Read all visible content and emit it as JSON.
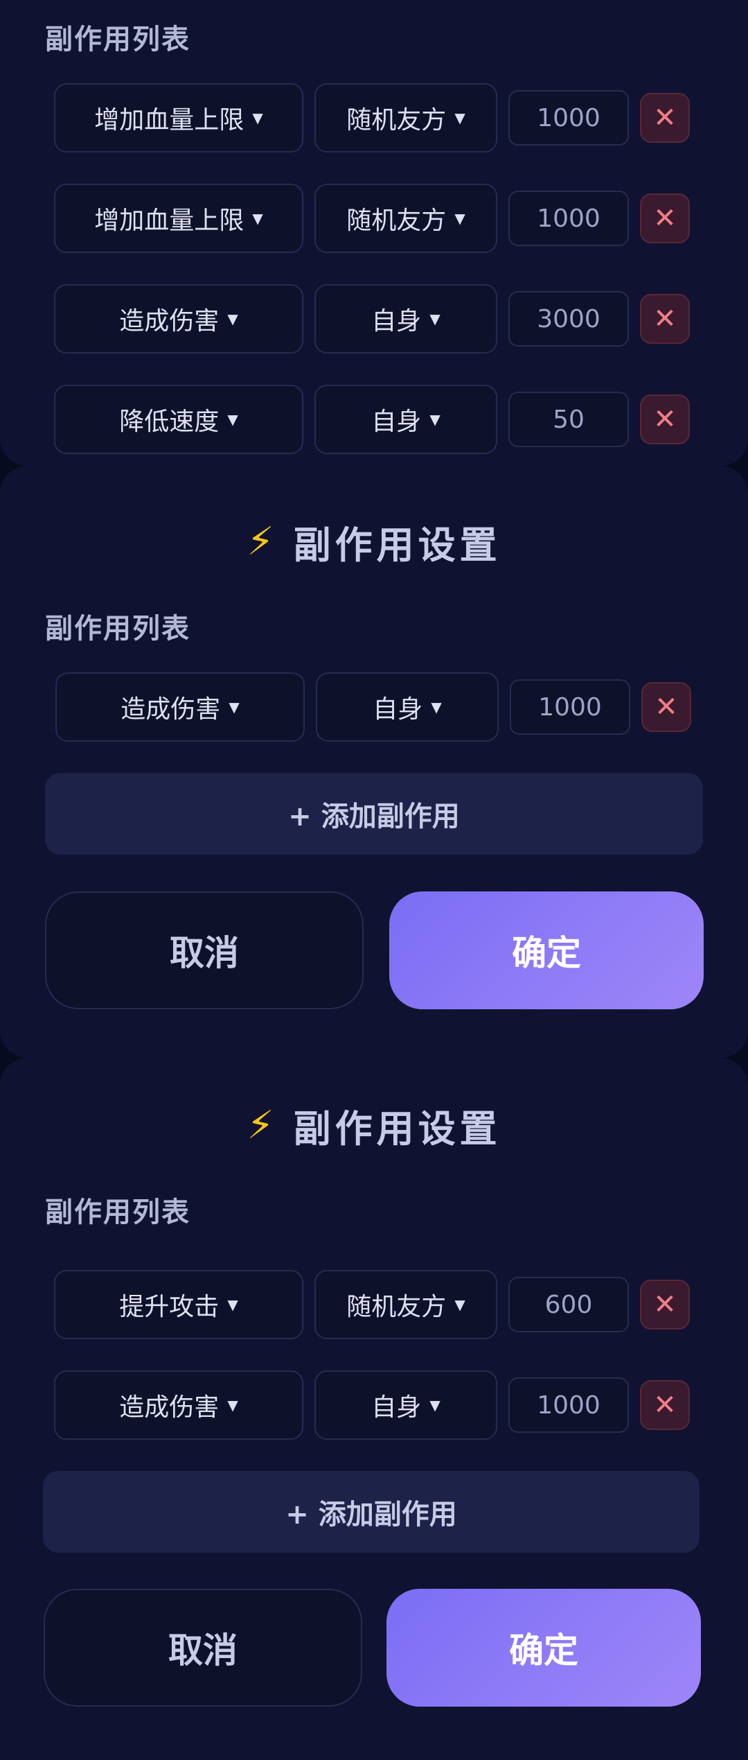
{
  "colors": {
    "background": "#070b20",
    "panel": "#0f1331",
    "accent_gradient_start": "#7b6ef4",
    "accent_gradient_end": "#9e86f8",
    "delete_icon": "#f07f86",
    "bolt_icon": "#f5c518"
  },
  "panel1": {
    "list_label": "副作用列表",
    "rows": [
      {
        "type": "增加血量上限",
        "target": "随机友方",
        "value": "1000"
      },
      {
        "type": "增加血量上限",
        "target": "随机友方",
        "value": "1000"
      },
      {
        "type": "造成伤害",
        "target": "自身",
        "value": "3000"
      },
      {
        "type": "降低速度",
        "target": "自身",
        "value": "50"
      }
    ]
  },
  "panel2": {
    "icon": "lightning-bolt-icon",
    "title": "副作用设置",
    "list_label": "副作用列表",
    "rows": [
      {
        "type": "造成伤害",
        "target": "自身",
        "value": "1000"
      }
    ],
    "add_label": "+ 添加副作用",
    "cancel_label": "取消",
    "confirm_label": "确定"
  },
  "panel3": {
    "icon": "lightning-bolt-icon",
    "title": "副作用设置",
    "list_label": "副作用列表",
    "rows": [
      {
        "type": "提升攻击",
        "target": "随机友方",
        "value": "600"
      },
      {
        "type": "造成伤害",
        "target": "自身",
        "value": "1000"
      }
    ],
    "add_label": "+ 添加副作用",
    "cancel_label": "取消",
    "confirm_label": "确定"
  }
}
